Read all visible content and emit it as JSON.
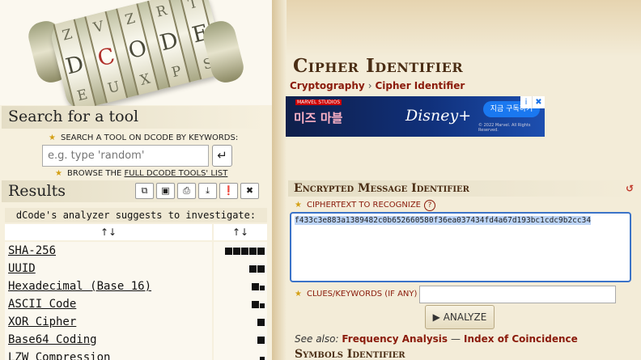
{
  "logo": {
    "letters": [
      "D",
      "C",
      "O",
      "D",
      "E"
    ],
    "accent_letter_index": 1
  },
  "sidebar": {
    "search_heading": "Search for a tool",
    "search_label": "SEARCH A TOOL ON DCODE BY KEYWORDS:",
    "search_placeholder": "e.g. type 'random'",
    "browse_prefix": "BROWSE THE",
    "browse_link": "FULL DCODE TOOLS' LIST",
    "results_heading": "Results",
    "analyzer_line": "dCode's analyzer suggests to investigate:",
    "sort_symbol": "↑↓",
    "results": [
      {
        "name": "SHA-256",
        "score": 5
      },
      {
        "name": "UUID",
        "score": 2
      },
      {
        "name": "Hexadecimal (Base 16)",
        "score": 1.5
      },
      {
        "name": "ASCII Code",
        "score": 1.5
      },
      {
        "name": "XOR Cipher",
        "score": 1
      },
      {
        "name": "Base64 Coding",
        "score": 1
      },
      {
        "name": "LZW Compression",
        "score": 0.5
      }
    ]
  },
  "main": {
    "title": "Cipher Identifier",
    "breadcrumb": [
      "Cryptography",
      "Cipher Identifier"
    ],
    "ad": {
      "brand": "미즈 마블",
      "small": "MARVEL STUDIOS",
      "logo": "Disney+",
      "button": "지금 구독하기",
      "fine": "© 2022 Marvel. All Rights Reserved."
    },
    "tool_heading": "Encrypted Message Identifier",
    "ciphertext_label": "CIPHERTEXT TO RECOGNIZE",
    "ciphertext": "f433c3e883a1389482c0b652660580f36ea037434fd4a67d193bc1cdc9b2cc34",
    "clues_label": "CLUES/KEYWORDS (IF ANY)",
    "analyze_label": "▶ ANALYZE",
    "see_also_prefix": "See also:",
    "see_also_links": [
      "Frequency Analysis",
      "Index of Coincidence"
    ],
    "next_heading": "Symbols Identifier"
  },
  "colors": {
    "accent": "#8a1a0a",
    "heading": "#4a2d14",
    "selection": "#bcd4f6"
  }
}
